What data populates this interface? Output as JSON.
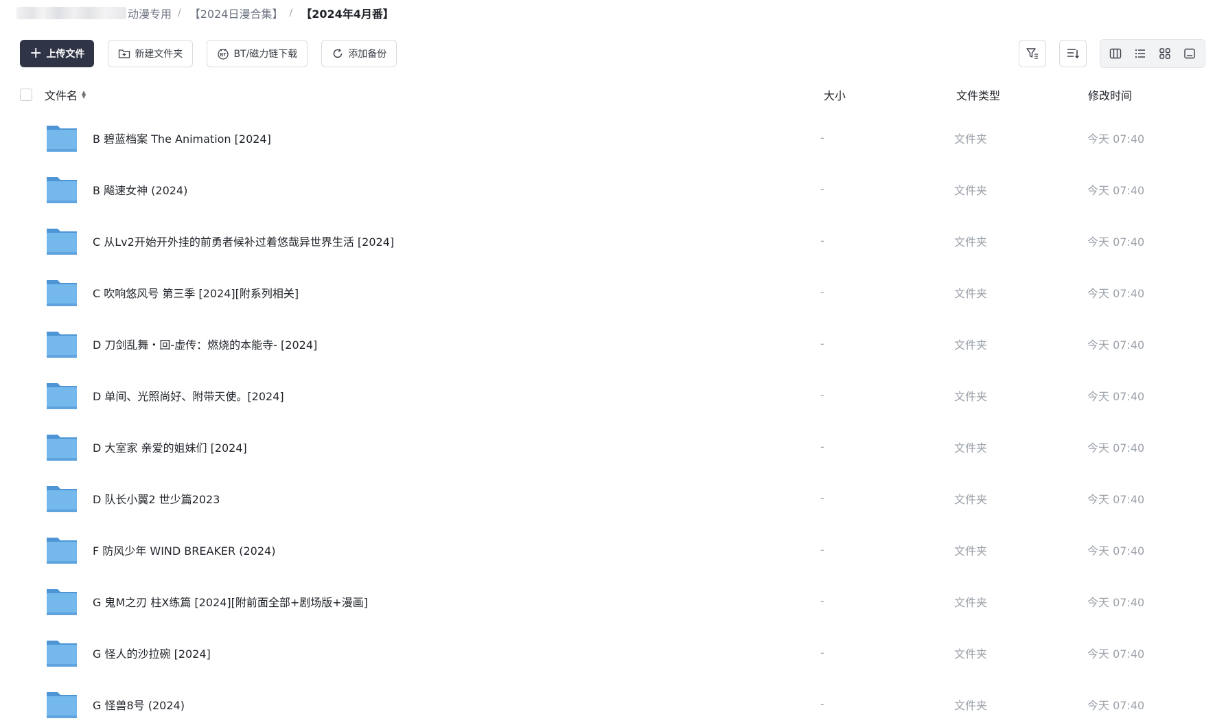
{
  "breadcrumb": {
    "items": [
      {
        "label": "动漫专用"
      },
      {
        "label": "【2024日漫合集】"
      },
      {
        "label": "【2024年4月番】"
      }
    ],
    "separator": "/"
  },
  "toolbar": {
    "upload_label": "上传文件",
    "new_folder_label": "新建文件夹",
    "bt_download_label": "BT/磁力链下载",
    "add_backup_label": "添加备份"
  },
  "table": {
    "columns": {
      "name": "文件名",
      "size": "大小",
      "type": "文件类型",
      "modified": "修改时间"
    },
    "rows": [
      {
        "name": "B 碧蓝档案 The Animation [2024]",
        "size": "-",
        "type": "文件夹",
        "modified": "今天 07:40"
      },
      {
        "name": "B 飚速女神 (2024)",
        "size": "-",
        "type": "文件夹",
        "modified": "今天 07:40"
      },
      {
        "name": "C 从Lv2开始开外挂的前勇者候补过着悠哉异世界生活 [2024]",
        "size": "-",
        "type": "文件夹",
        "modified": "今天 07:40"
      },
      {
        "name": "C 吹响悠风号 第三季 [2024][附系列相关]",
        "size": "-",
        "type": "文件夹",
        "modified": "今天 07:40"
      },
      {
        "name": "D 刀剑乱舞・回-虚传：燃烧的本能寺- [2024]",
        "size": "-",
        "type": "文件夹",
        "modified": "今天 07:40"
      },
      {
        "name": "D 单间、光照尚好、附带天使。[2024]",
        "size": "-",
        "type": "文件夹",
        "modified": "今天 07:40"
      },
      {
        "name": "D 大室家 亲爱的姐妹们 [2024]",
        "size": "-",
        "type": "文件夹",
        "modified": "今天 07:40"
      },
      {
        "name": "D 队长小翼2 世少篇2023",
        "size": "-",
        "type": "文件夹",
        "modified": "今天 07:40"
      },
      {
        "name": "F 防风少年 WIND BREAKER (2024)",
        "size": "-",
        "type": "文件夹",
        "modified": "今天 07:40"
      },
      {
        "name": "G 鬼M之刃 柱X练篇 [2024][附前面全部+剧场版+漫画]",
        "size": "-",
        "type": "文件夹",
        "modified": "今天 07:40"
      },
      {
        "name": "G 怪人的沙拉碗 [2024]",
        "size": "-",
        "type": "文件夹",
        "modified": "今天 07:40"
      },
      {
        "name": "G 怪兽8号 (2024)",
        "size": "-",
        "type": "文件夹",
        "modified": "今天 07:40"
      }
    ]
  },
  "icons": {
    "folder": "folder-icon",
    "upload": "plus-icon",
    "new_folder": "folder-plus-icon",
    "bt": "bt-icon",
    "backup": "refresh-icon",
    "filter": "filter-icon",
    "sort": "sort-icon",
    "views": [
      "column-view-icon",
      "list-view-icon",
      "grid-view-icon",
      "preview-view-icon"
    ]
  },
  "colors": {
    "primary_button": "#2f3446",
    "folder_blue": "#64aee8",
    "muted_text": "#9aa0a8"
  }
}
